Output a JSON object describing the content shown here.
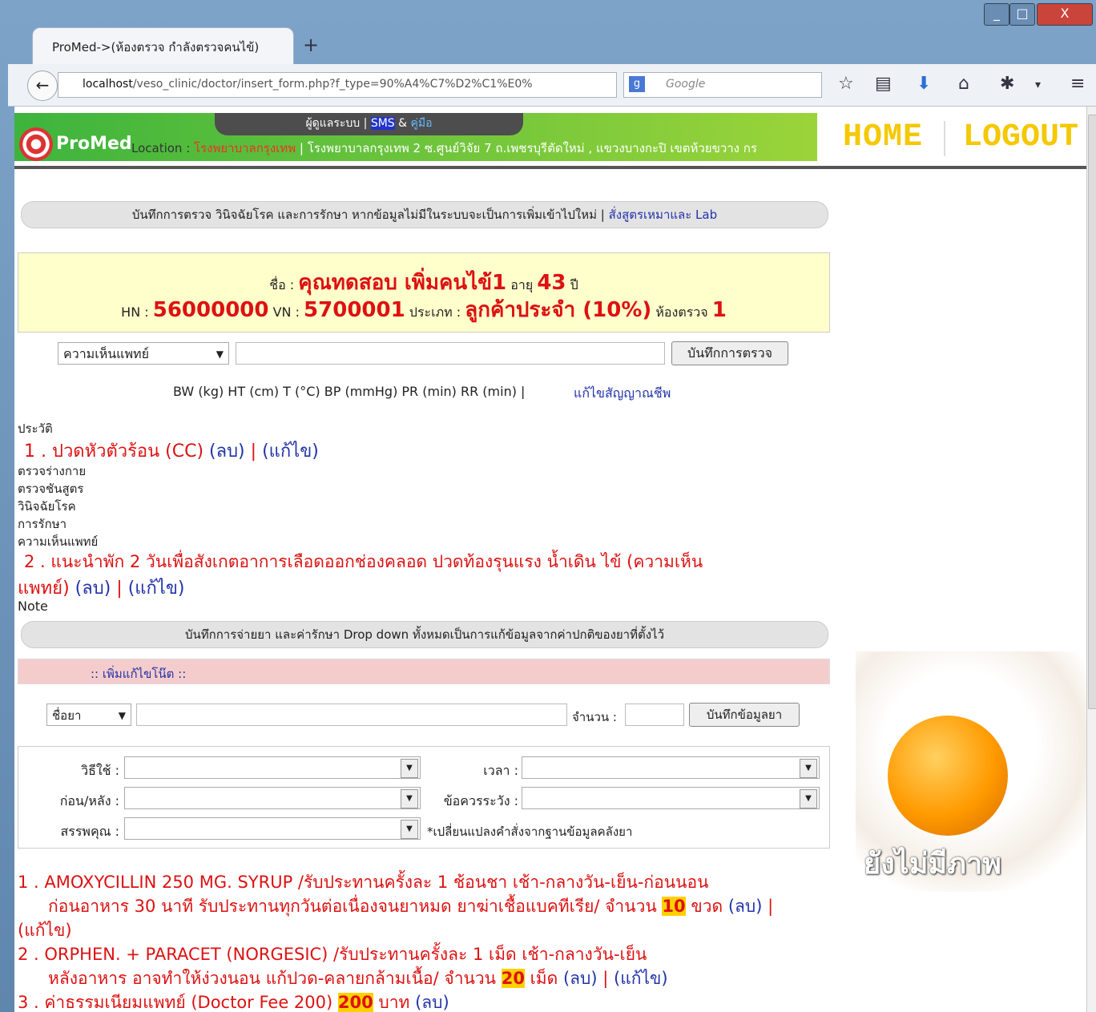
{
  "browser": {
    "tab_title": "ProMed->(ห้องตรวจ กำลังตรวจคนไข้)",
    "new_tab": "+",
    "url_host": "localhost",
    "url_path": "/veso_clinic/doctor/insert_form.php?f_type=90%A4%C7%D2%C1%E0%",
    "search_placeholder": "Google",
    "win_min": "_",
    "win_max": "□",
    "win_close": "X"
  },
  "header": {
    "topbar_users": "ผู้ดูแลระบบ |",
    "topbar_sms": "SMS",
    "topbar_amp": "&",
    "topbar_manual": "คู่มือ",
    "brand": "ProMed",
    "location_label": "Location :",
    "location_name": "โรงพยาบาลกรุงเทพ",
    "location_address": "| โรงพยาบาลกรุงเทพ 2 ซ.ศูนย์วิจัย 7 ถ.เพชรบุรีตัดใหม่ , แขวงบางกะปิ เขตห้วยขวาง กร",
    "home": "HOME",
    "logout": "LOGOUT"
  },
  "exam_bar": {
    "text": "บันทึกการตรวจ วินิจฉัยโรค และการรักษา หากข้อมูลไม่มีในระบบจะเป็นการเพิ่มเข้าไปใหม่ |",
    "link": "สั่งสูตรเหมาและ Lab"
  },
  "patient": {
    "name_label": "ชื่อ :",
    "name": "คุณทดสอบ เพิ่มคนไข้1",
    "age_label": "อายุ",
    "age": "43",
    "age_unit": "ปี",
    "hn_label": "HN :",
    "hn": "56000000",
    "vn_label": "VN :",
    "vn": "5700001",
    "type_label": "ประเภท :",
    "type": "ลูกค้าประจำ (10%)",
    "room_label": "ห้องตรวจ",
    "room": "1"
  },
  "exam_form": {
    "category": "ความเห็นแพทย์",
    "save_button": "บันทึกการตรวจ",
    "vitals": "BW (kg) HT (cm) T (°C) BP (mmHg) PR (min) RR (min) |",
    "edit_vitals": "แก้ไขสัญญาณชีพ"
  },
  "history": {
    "history_label": "ประวัติ",
    "item1": "1 . ปวดหัวตัวร้อน (CC)",
    "item1_delete": "(ลบ)",
    "item1_sep": "|",
    "item1_edit": "(แก้ไข)",
    "physical": "ตรวจร่างกาย",
    "lab": "ตรวจชันสูตร",
    "diagnosis": "วินิจฉัยโรค",
    "treatment": "การรักษา",
    "opinion": "ความเห็นแพทย์",
    "item2_line1": "2 . แนะนำพัก 2 วันเพื่อสังเกตอาการเลือดออกช่องคลอด ปวดท้องรุนแรง น้ำเดิน ไข้ (ความเห็น",
    "item2_line2": "แพทย์)",
    "item2_delete": "(ลบ)",
    "item2_sep": "|",
    "item2_edit": "(แก้ไข)",
    "note": "Note"
  },
  "drug_bar": {
    "text": "บันทึกการจ่ายยา และค่ารักษา Drop down ทั้งหมดเป็นการแก้ข้อมูลจากค่าปกติของยาที่ตั้งไว้"
  },
  "note_bar": {
    "text": ":: เพิ่มแก้ไขโน๊ต ::"
  },
  "drug_form": {
    "drug_select": "ชื่อยา",
    "qty_label": "จำนวน :",
    "save_button": "บันทึกข้อมูลยา",
    "usage_label": "วิธีใช้ :",
    "time_label": "เวลา :",
    "before_after_label": "ก่อน/หลัง :",
    "caution_label": "ข้อควรระวัง :",
    "property_label": "สรรพคุณ :",
    "change_note": "*เปลี่ยนแปลงคำสั่งจากฐานข้อมูลคลังยา"
  },
  "rx": {
    "item1_line1": "1 . AMOXYCILLIN 250 MG. SYRUP /รับประทานครั้งละ 1 ช้อนชา เช้า-กลางวัน-เย็น-ก่อนนอน",
    "item1_line2": "ก่อนอาหาร 30 นาที รับประทานทุกวันต่อเนื่องจนยาหมด ยาฆ่าเชื้อแบคทีเรีย/ จำนวน",
    "item1_qty": "10",
    "item1_unit": "ขวด",
    "item1_delete": "(ลบ)",
    "item1_sep": "|",
    "item1_edit": "(แก้ไข)",
    "item2_line1": "2 . ORPHEN. + PARACET (NORGESIC) /รับประทานครั้งละ 1 เม็ด เช้า-กลางวัน-เย็น",
    "item2_line2": "หลังอาหาร อาจทำให้ง่วงนอน แก้ปวด-คลายกล้ามเนื้อ/ จำนวน",
    "item2_qty": "20",
    "item2_unit": "เม็ด",
    "item2_delete": "(ลบ)",
    "item2_sep": "|",
    "item2_edit": "(แก้ไข)",
    "item3": "3 . ค่าธรรมเนียมแพทย์ (Doctor Fee 200)",
    "item3_qty": "200",
    "item3_unit": "บาท",
    "item3_delete": "(ลบ)"
  },
  "side": {
    "no_image": "ยังไม่มีภาพ"
  },
  "colors": {
    "accent_red": "#dd1111",
    "link_blue": "#2233aa",
    "highlight": "#ffd000",
    "home_yellow": "#f5c800"
  }
}
